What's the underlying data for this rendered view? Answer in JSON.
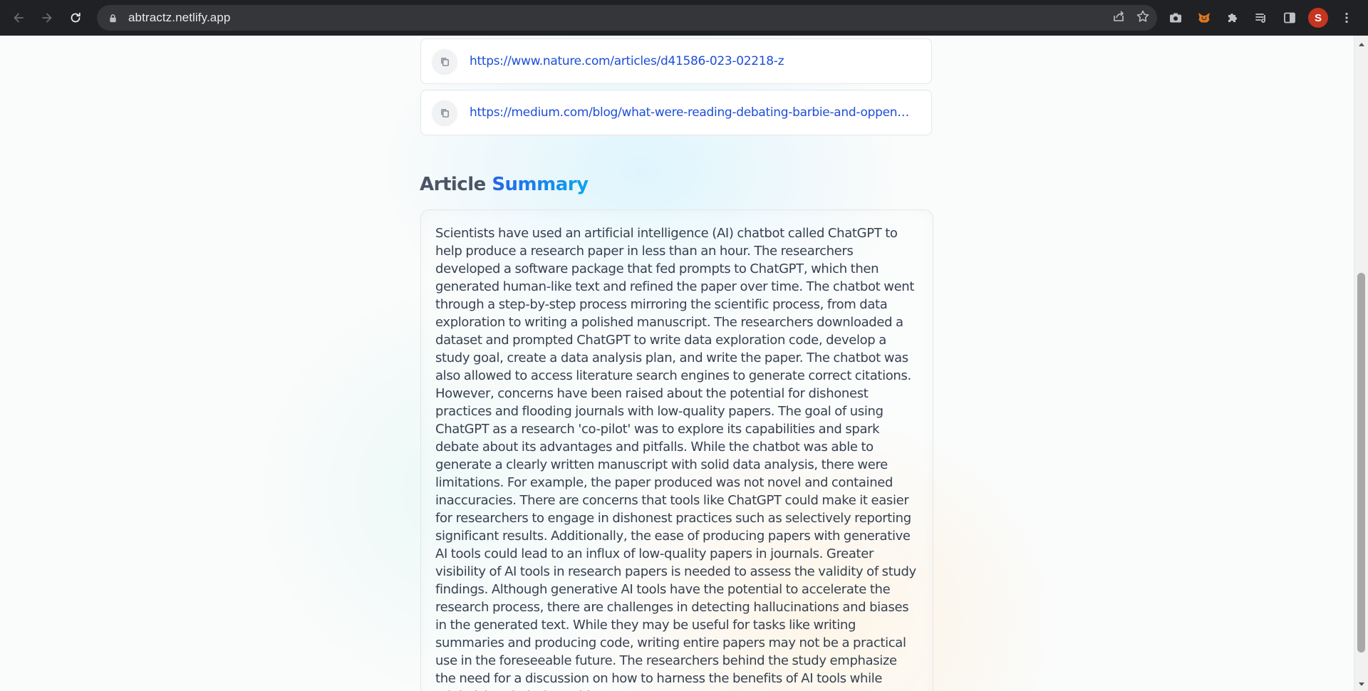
{
  "browser": {
    "url": "abtractz.netlify.app",
    "profile_initial": "S",
    "icons": [
      "back-icon",
      "forward-icon",
      "reload-icon",
      "lock-icon",
      "share-icon",
      "bookmark-star-icon",
      "camera-icon",
      "metamask-fox-icon",
      "extensions-puzzle-icon",
      "reading-list-icon",
      "side-panel-icon",
      "more-menu-icon"
    ]
  },
  "history": {
    "links": [
      {
        "url": "https://www.nature.com/articles/d41586-023-02218-z"
      },
      {
        "url": "https://medium.com/blog/what-were-reading-debating-barbie-and-oppenhei..."
      }
    ]
  },
  "summary": {
    "title_prefix": "Article",
    "title_accent": "Summary",
    "text": "Scientists have used an artificial intelligence (AI) chatbot called ChatGPT to help produce a research paper in less than an hour. The researchers developed a software package that fed prompts to ChatGPT, which then generated human-like text and refined the paper over time. The chatbot went through a step-by-step process mirroring the scientific process, from data exploration to writing a polished manuscript. The researchers downloaded a dataset and prompted ChatGPT to write data exploration code, develop a study goal, create a data analysis plan, and write the paper. The chatbot was also allowed to access literature search engines to generate correct citations. However, concerns have been raised about the potential for dishonest practices and flooding journals with low-quality papers. The goal of using ChatGPT as a research 'co-pilot' was to explore its capabilities and spark debate about its advantages and pitfalls. While the chatbot was able to generate a clearly written manuscript with solid data analysis, there were limitations. For example, the paper produced was not novel and contained inaccuracies. There are concerns that tools like ChatGPT could make it easier for researchers to engage in dishonest practices such as selectively reporting significant results. Additionally, the ease of producing papers with generative AI tools could lead to an influx of low-quality papers in journals. Greater visibility of AI tools in research papers is needed to assess the validity of study findings. Although generative AI tools have the potential to accelerate the research process, there are challenges in detecting hallucinations and biases in the generated text. While they may be useful for tasks like writing summaries and producing code, writing entire papers may not be a practical use in the foreseeable future. The researchers behind the study emphasize the need for a discussion on how to harness the benefits of AI tools while minimizing their downsides."
  },
  "colors": {
    "chrome_bg": "#202124",
    "omnibox_bg": "#35363a",
    "link_blue": "#1d4ed8",
    "accent_gradient_start": "#2563eb",
    "accent_gradient_end": "#0ea5e9",
    "profile_red": "#c5351f"
  }
}
